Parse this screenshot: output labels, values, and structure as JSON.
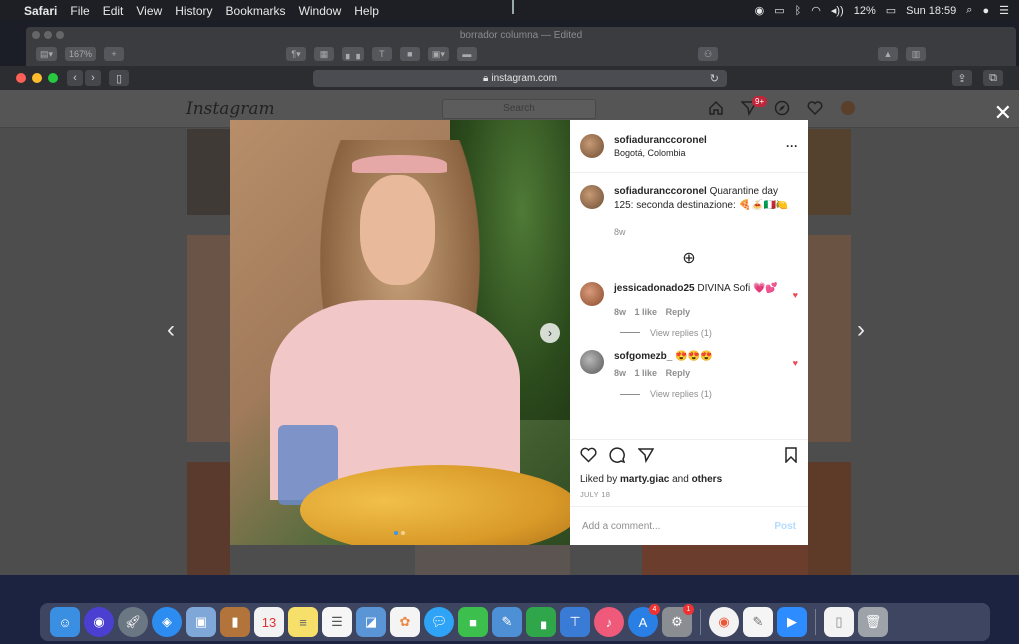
{
  "menubar": {
    "app_name": "Safari",
    "items": [
      "File",
      "Edit",
      "View",
      "History",
      "Bookmarks",
      "Window",
      "Help"
    ],
    "battery": "12%",
    "clock": "Sun 18:59"
  },
  "pages_window": {
    "title": "borrador columna — Edited",
    "zoom": "167%"
  },
  "safari": {
    "url": "instagram.com"
  },
  "instagram": {
    "logo": "Instagram",
    "search_placeholder": "Search",
    "notification_count": "9+"
  },
  "post": {
    "username": "sofiaduranccoronel",
    "location": "Bogotá, Colombia",
    "caption_user": "sofiaduranccoronel",
    "caption_text": "Quarantine day 125: seconda destinazione: 🍕🍝🇮🇹🍋",
    "caption_age": "8w",
    "comments": [
      {
        "user": "jessicadonado25",
        "text": "DIVINA Sofi 💗💕",
        "age": "8w",
        "likes": "1 like",
        "reply": "Reply",
        "view_replies": "View replies (1)"
      },
      {
        "user": "sofgomezb_",
        "text": "😍😍😍",
        "age": "8w",
        "likes": "1 like",
        "reply": "Reply",
        "view_replies": "View replies (1)"
      }
    ],
    "liked_by_prefix": "Liked by",
    "liked_by_user": "marty.giac",
    "liked_by_suffix": "and",
    "liked_by_others": "others",
    "date": "JULY 18",
    "add_comment_placeholder": "Add a comment...",
    "post_button": "Post"
  },
  "colors": {
    "like_red": "#ed4956",
    "post_blue": "#b3dbff",
    "link_blue": "#3897f0"
  }
}
